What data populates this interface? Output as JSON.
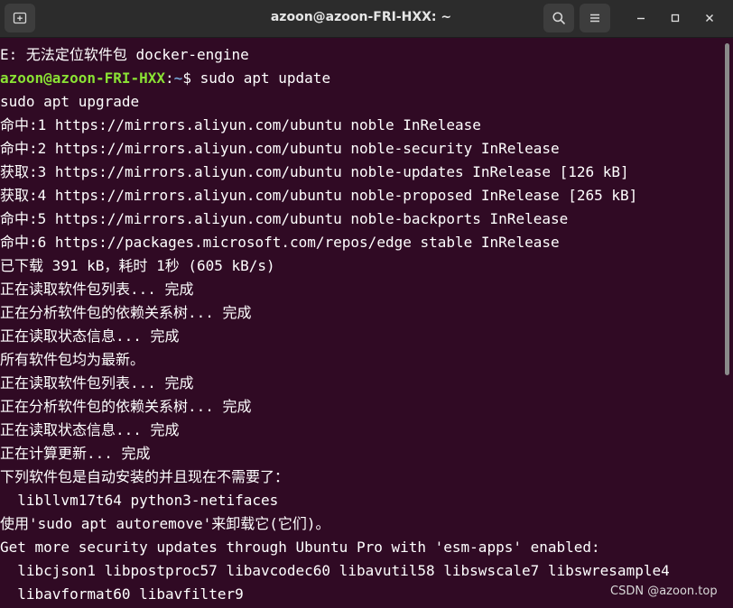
{
  "window": {
    "title": "azoon@azoon-FRI-HXX: ~"
  },
  "icons": {
    "new_tab": "new-tab-icon",
    "search": "search-icon",
    "menu": "hamburger-menu-icon",
    "minimize": "minimize-icon",
    "maximize": "maximize-icon",
    "close": "close-icon"
  },
  "colors": {
    "background": "#300a24",
    "titlebar": "#2c2c2c",
    "prompt_user": "#8ae234",
    "prompt_path": "#729fcf",
    "text": "#ffffff"
  },
  "terminal": {
    "line0": "E: 无法定位软件包 docker-engine",
    "prompt": {
      "user_host": "azoon@azoon-FRI-HXX",
      "sep": ":",
      "path": "~",
      "symbol": "$ ",
      "command": "sudo apt update"
    },
    "lines": [
      "sudo apt upgrade",
      "命中:1 https://mirrors.aliyun.com/ubuntu noble InRelease",
      "命中:2 https://mirrors.aliyun.com/ubuntu noble-security InRelease",
      "获取:3 https://mirrors.aliyun.com/ubuntu noble-updates InRelease [126 kB]",
      "获取:4 https://mirrors.aliyun.com/ubuntu noble-proposed InRelease [265 kB]",
      "命中:5 https://mirrors.aliyun.com/ubuntu noble-backports InRelease",
      "命中:6 https://packages.microsoft.com/repos/edge stable InRelease",
      "已下载 391 kB，耗时 1秒 (605 kB/s)",
      "正在读取软件包列表... 完成",
      "正在分析软件包的依赖关系树... 完成",
      "正在读取状态信息... 完成",
      "所有软件包均为最新。",
      "正在读取软件包列表... 完成",
      "正在分析软件包的依赖关系树... 完成",
      "正在读取状态信息... 完成",
      "正在计算更新... 完成",
      "下列软件包是自动安装的并且现在不需要了：",
      "  libllvm17t64 python3-netifaces",
      "使用'sudo apt autoremove'来卸载它(它们)。",
      "Get more security updates through Ubuntu Pro with 'esm-apps' enabled:",
      "  libcjson1 libpostproc57 libavcodec60 libavutil58 libswscale7 libswresample4",
      "  libavformat60 libavfilter9"
    ]
  },
  "watermark": "CSDN @azoon.top"
}
